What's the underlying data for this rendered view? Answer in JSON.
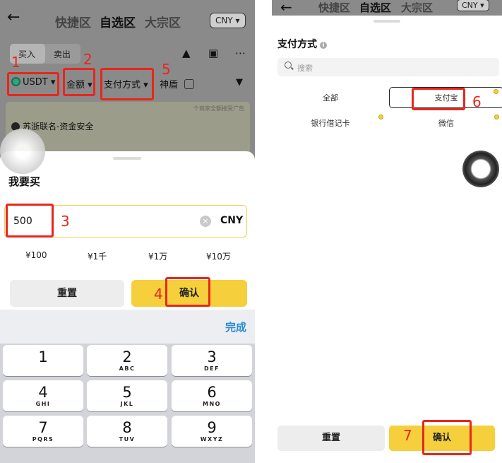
{
  "left_screen": {
    "header": {
      "back_icon": "arrow-left-icon",
      "tabs": [
        "快捷区",
        "自选区",
        "大宗区"
      ],
      "active_tab": "自选区",
      "currency": "CNY ▾"
    },
    "trade_tabs": {
      "buy": "买入",
      "sell": "卖出"
    },
    "filters": {
      "coin": "USDT",
      "amount": "金额",
      "payment": "支付方式",
      "shield": "神盾"
    },
    "ad_card": {
      "note": "个商家全额接受广告",
      "merchant": "苏浙联名-资金安全"
    },
    "sheet": {
      "title": "我要买",
      "amount_value": "500",
      "amount_unit": "CNY",
      "quick_amounts": [
        "¥100",
        "¥1千",
        "¥1万",
        "¥10万"
      ],
      "reset": "重置",
      "confirm": "确认"
    },
    "keyboard": {
      "done": "完成",
      "keys": [
        {
          "num": "1",
          "sub": ""
        },
        {
          "num": "2",
          "sub": "ABC"
        },
        {
          "num": "3",
          "sub": "DEF"
        },
        {
          "num": "4",
          "sub": "GHI"
        },
        {
          "num": "5",
          "sub": "JKL"
        },
        {
          "num": "6",
          "sub": "MNO"
        },
        {
          "num": "7",
          "sub": "PQRS"
        },
        {
          "num": "8",
          "sub": "TUV"
        },
        {
          "num": "9",
          "sub": "WXYZ"
        }
      ]
    }
  },
  "right_screen": {
    "header": {
      "back_icon": "arrow-left-icon",
      "tabs": [
        "快捷区",
        "自选区",
        "大宗区"
      ],
      "currency": "CNY ▾"
    },
    "sheet": {
      "title": "支付方式",
      "search_placeholder": "搜索",
      "options": [
        "全部",
        "支付宝",
        "银行借记卡",
        "微信"
      ],
      "selected": "支付宝",
      "reset": "重置",
      "confirm": "确认"
    }
  },
  "annotations": [
    "1",
    "2",
    "3",
    "4",
    "5",
    "6",
    "7"
  ],
  "colors": {
    "accent_yellow": "#f5cf3c",
    "annotation_red": "#e8261c",
    "done_blue": "#2a8bd8"
  }
}
